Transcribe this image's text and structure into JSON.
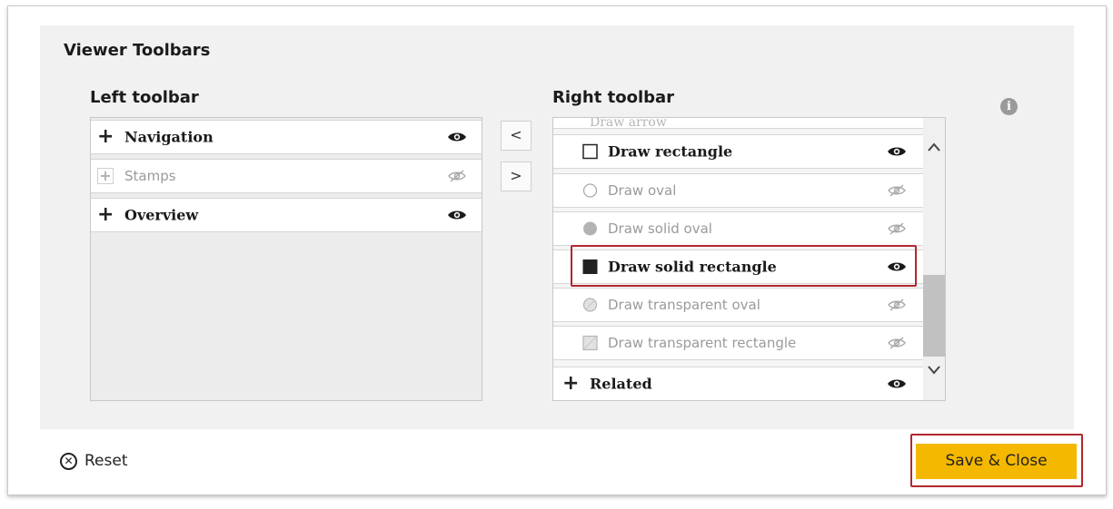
{
  "dialog": {
    "section_title": "Viewer Toolbars",
    "left_title": "Left toolbar",
    "right_title": "Right toolbar",
    "info_icon": "i"
  },
  "left_toolbar": {
    "items": [
      {
        "label": "Navigation",
        "visible": true
      },
      {
        "label": "Stamps",
        "visible": false
      },
      {
        "label": "Overview",
        "visible": true
      }
    ]
  },
  "move_buttons": {
    "left": "<",
    "right": ">"
  },
  "right_toolbar": {
    "cut_off_item": "Draw arrow",
    "items": [
      {
        "label": "Draw rectangle",
        "visible": true,
        "icon": "empty-square-icon"
      },
      {
        "label": "Draw oval",
        "visible": false,
        "icon": "empty-circle-icon"
      },
      {
        "label": "Draw solid oval",
        "visible": false,
        "icon": "solid-circle-icon"
      },
      {
        "label": "Draw solid rectangle",
        "visible": true,
        "icon": "solid-square-icon"
      },
      {
        "label": "Draw transparent oval",
        "visible": false,
        "icon": "transparent-circle-icon"
      },
      {
        "label": "Draw transparent rectangle",
        "visible": false,
        "icon": "transparent-square-icon"
      }
    ],
    "group_item": {
      "label": "Related",
      "visible": true
    }
  },
  "footer": {
    "reset_label": "Reset",
    "save_label": "Save & Close"
  },
  "colors": {
    "accent": "#f5b800",
    "highlight": "#b2272d"
  }
}
